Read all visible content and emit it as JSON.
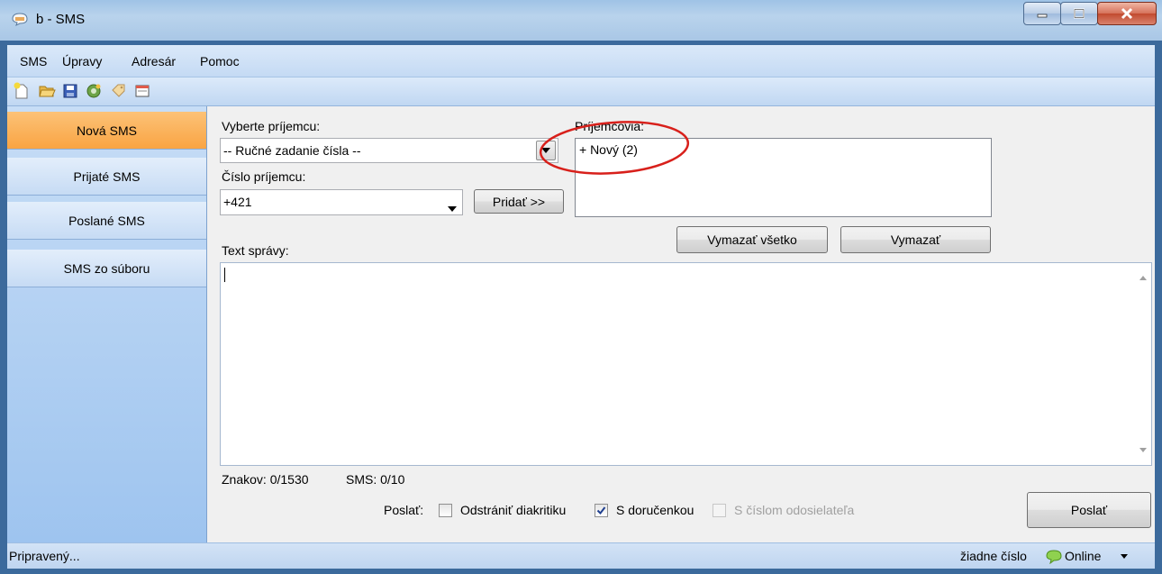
{
  "window": {
    "title": "b - SMS",
    "minimize_label": "minimize",
    "maximize_label": "maximize",
    "close_label": "close"
  },
  "menu": [
    "SMS",
    "Úpravy",
    "Adresár",
    "Pomoc"
  ],
  "toolbar": {
    "icons": [
      "new-icon",
      "open-folder-icon",
      "save-icon",
      "settings-icon",
      "tag-icon",
      "window-icon"
    ]
  },
  "sidebar": {
    "items": [
      {
        "label": "Nová SMS",
        "active": true
      },
      {
        "label": "Prijaté SMS",
        "active": false
      },
      {
        "label": "Poslané SMS",
        "active": false
      },
      {
        "label": "SMS zo súboru",
        "active": false
      }
    ]
  },
  "form": {
    "select_recipient_label": "Vyberte príjemcu:",
    "select_recipient_value": "-- Ručné zadanie čísla --",
    "recipient_number_label": "Číslo príjemcu:",
    "recipient_number_value": "+421",
    "add_button": "Pridať >>",
    "recipients_label": "Príjemcovia:",
    "recipients": [
      "+ Nový (2)"
    ],
    "clear_all_button": "Vymazať všetko",
    "clear_button": "Vymazať",
    "message_label": "Text správy:",
    "message_value": "",
    "char_count": "Znakov: 0/1530",
    "sms_count": "SMS: 0/10",
    "send_label": "Poslať:",
    "options": [
      {
        "label": "Odstrániť diakritiku",
        "checked": false,
        "enabled": true
      },
      {
        "label": "S doručenkou",
        "checked": true,
        "enabled": true
      },
      {
        "label": "S číslom odosielateľa",
        "checked": false,
        "enabled": false
      }
    ],
    "send_button": "Poslať"
  },
  "status": {
    "text": "Pripravený...",
    "number": "žiadne číslo",
    "connection": "Online"
  },
  "colors": {
    "active_tab": "#f9a443",
    "highlight_circle": "#d8201b"
  }
}
